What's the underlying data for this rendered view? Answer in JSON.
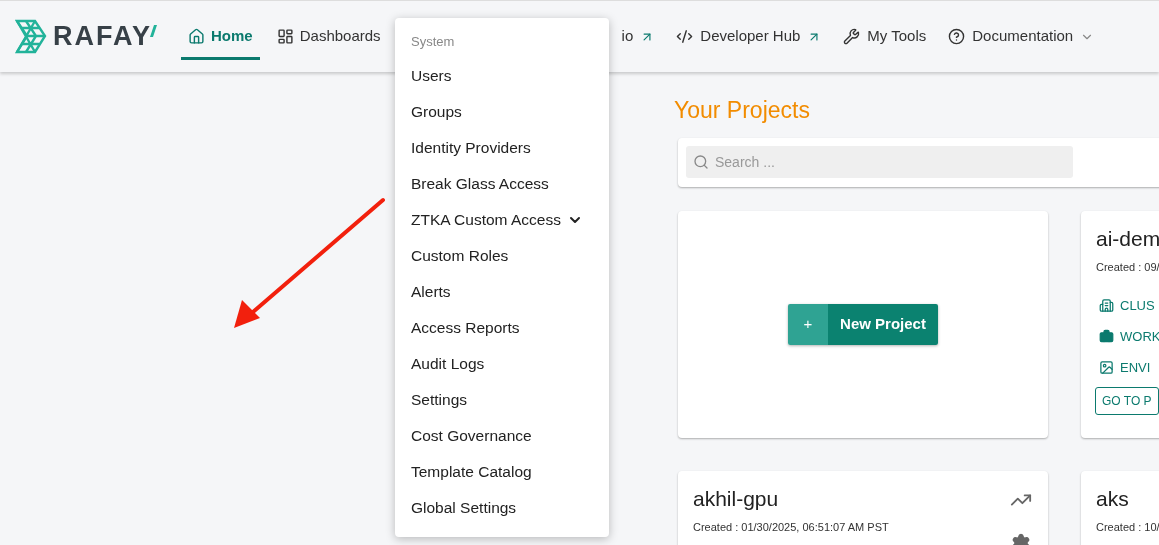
{
  "logo": {
    "text": "RAFAY"
  },
  "nav": [
    {
      "kind": "home",
      "label": "Home",
      "selected": true
    },
    {
      "kind": "dashboards",
      "label": "Dashboards",
      "selected": false
    },
    {
      "kind": "external-hidden",
      "label": "io",
      "selected": false
    },
    {
      "kind": "developer",
      "label": "Developer Hub",
      "selected": false
    },
    {
      "kind": "tools",
      "label": "My Tools",
      "selected": false
    },
    {
      "kind": "docs",
      "label": "Documentation",
      "selected": false
    }
  ],
  "menu": {
    "header": "System",
    "items": [
      {
        "label": "Users",
        "submenu": false
      },
      {
        "label": "Groups",
        "submenu": false
      },
      {
        "label": "Identity Providers",
        "submenu": false
      },
      {
        "label": "Break Glass Access",
        "submenu": false
      },
      {
        "label": "ZTKA Custom Access",
        "submenu": true
      },
      {
        "label": "Custom Roles",
        "submenu": false
      },
      {
        "label": "Alerts",
        "submenu": false
      },
      {
        "label": "Access Reports",
        "submenu": false
      },
      {
        "label": "Audit Logs",
        "submenu": false
      },
      {
        "label": "Settings",
        "submenu": false
      },
      {
        "label": "Cost Governance",
        "submenu": false
      },
      {
        "label": "Template Catalog",
        "submenu": false
      },
      {
        "label": "Global Settings",
        "submenu": false
      }
    ]
  },
  "title": "Your Projects",
  "search": {
    "placeholder": "Search ..."
  },
  "new_project": {
    "plus": "+",
    "label": "New Project"
  },
  "projects": [
    {
      "name": "ai-dem",
      "created": "Created : 09/",
      "links": [
        {
          "kind": "clusters",
          "label": "CLUS"
        },
        {
          "kind": "workloads",
          "label": "WORK"
        },
        {
          "kind": "environments",
          "label": "ENVI"
        }
      ],
      "button": "GO TO P"
    },
    {
      "name": "akhil-gpu",
      "created": "Created : 01/30/2025, 06:51:07 AM PST",
      "actions": true
    },
    {
      "name": "aks",
      "created": "Created : 10/"
    }
  ]
}
